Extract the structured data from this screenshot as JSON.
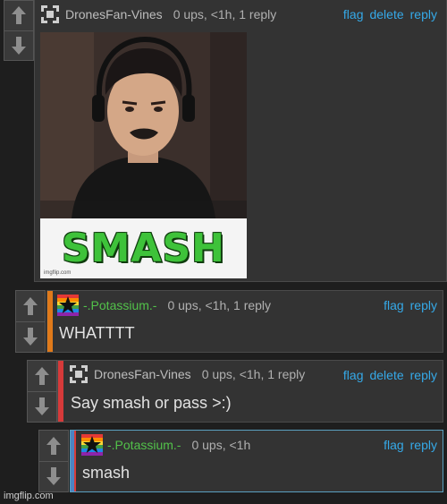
{
  "comments": [
    {
      "username": "DronesFan-Vines",
      "meta": "0 ups, <1h, 1 reply",
      "actions": [
        "flag",
        "delete",
        "reply"
      ],
      "image": {
        "caption": "SMASH",
        "watermark": "imgflip.com"
      }
    },
    {
      "username": "-.Potassium.-",
      "meta": "0 ups, <1h, 1 reply",
      "actions": [
        "flag",
        "reply"
      ],
      "text": "WHATTTT"
    },
    {
      "username": "DronesFan-Vines",
      "meta": "0 ups, <1h, 1 reply",
      "actions": [
        "flag",
        "delete",
        "reply"
      ],
      "text": "Say smash or pass >:)"
    },
    {
      "username": "-.Potassium.-",
      "meta": "0 ups, <1h",
      "actions": [
        "flag",
        "reply"
      ],
      "text": "smash"
    }
  ],
  "watermark": "imgflip.com",
  "colors": {
    "link": "#35a9e8",
    "op_username": "#bdbdbd",
    "reply_username": "#52c24a",
    "thread_orange": "#e07a1a",
    "thread_red": "#d63a3a",
    "thread_blue": "#4c84c4"
  }
}
